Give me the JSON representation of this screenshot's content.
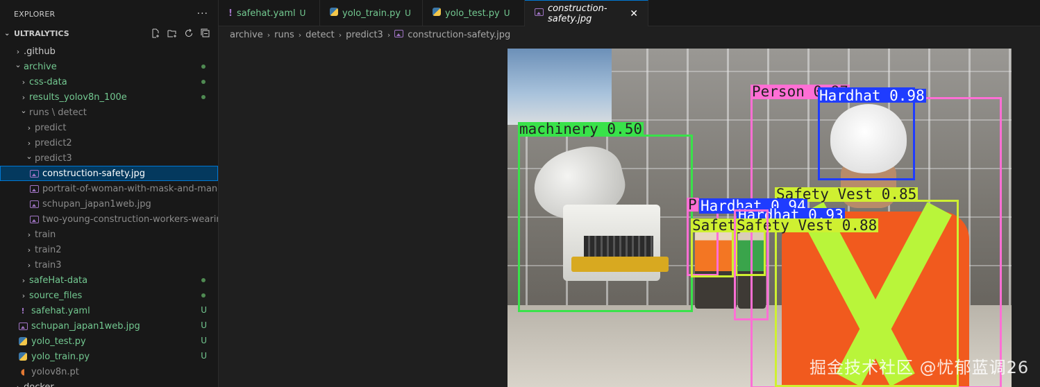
{
  "explorer": {
    "title": "EXPLORER",
    "more": "···",
    "section_title": "ULTRALYTICS",
    "tree": [
      {
        "label": ".github",
        "kind": "folder",
        "depth": 0,
        "open": false,
        "color": "normal",
        "marker": ""
      },
      {
        "label": "archive",
        "kind": "folder",
        "depth": 0,
        "open": true,
        "color": "green",
        "marker": "dot"
      },
      {
        "label": "css-data",
        "kind": "folder",
        "depth": 1,
        "open": false,
        "color": "green",
        "marker": "dot"
      },
      {
        "label": "results_yolov8n_100e",
        "kind": "folder",
        "depth": 1,
        "open": false,
        "color": "green",
        "marker": "dot"
      },
      {
        "label": "runs \\ detect",
        "kind": "folder",
        "depth": 1,
        "open": true,
        "color": "gray",
        "marker": ""
      },
      {
        "label": "predict",
        "kind": "folder",
        "depth": 2,
        "open": false,
        "color": "gray",
        "marker": ""
      },
      {
        "label": "predict2",
        "kind": "folder",
        "depth": 2,
        "open": false,
        "color": "gray",
        "marker": ""
      },
      {
        "label": "predict3",
        "kind": "folder",
        "depth": 2,
        "open": true,
        "color": "gray",
        "marker": ""
      },
      {
        "label": "construction-safety.jpg",
        "kind": "image",
        "depth": 3,
        "color": "normal",
        "marker": "",
        "selected": true
      },
      {
        "label": "portrait-of-woman-with-mask-and-man-w...",
        "kind": "image",
        "depth": 3,
        "color": "gray",
        "marker": ""
      },
      {
        "label": "schupan_japan1web.jpg",
        "kind": "image",
        "depth": 3,
        "color": "gray",
        "marker": ""
      },
      {
        "label": "two-young-construction-workers-wearing-...",
        "kind": "image",
        "depth": 3,
        "color": "gray",
        "marker": ""
      },
      {
        "label": "train",
        "kind": "folder",
        "depth": 2,
        "open": false,
        "color": "gray",
        "marker": ""
      },
      {
        "label": "train2",
        "kind": "folder",
        "depth": 2,
        "open": false,
        "color": "gray",
        "marker": ""
      },
      {
        "label": "train3",
        "kind": "folder",
        "depth": 2,
        "open": false,
        "color": "gray",
        "marker": ""
      },
      {
        "label": "safeHat-data",
        "kind": "folder",
        "depth": 1,
        "open": false,
        "color": "green",
        "marker": "dot"
      },
      {
        "label": "source_files",
        "kind": "folder",
        "depth": 1,
        "open": false,
        "color": "green",
        "marker": "dot"
      },
      {
        "label": "safehat.yaml",
        "kind": "yaml",
        "depth": 1,
        "color": "green",
        "marker": "U"
      },
      {
        "label": "schupan_japan1web.jpg",
        "kind": "image",
        "depth": 1,
        "color": "green",
        "marker": "U"
      },
      {
        "label": "yolo_test.py",
        "kind": "python",
        "depth": 1,
        "color": "green",
        "marker": "U"
      },
      {
        "label": "yolo_train.py",
        "kind": "python",
        "depth": 1,
        "color": "green",
        "marker": "U"
      },
      {
        "label": "yolov8n.pt",
        "kind": "rss",
        "depth": 1,
        "color": "gray",
        "marker": ""
      },
      {
        "label": "docker",
        "kind": "folder",
        "depth": 0,
        "open": false,
        "color": "normal",
        "marker": ""
      }
    ]
  },
  "tabs": [
    {
      "name": "safehat.yaml",
      "status": "U",
      "icon": "yaml-icon",
      "active": false
    },
    {
      "name": "yolo_train.py",
      "status": "U",
      "icon": "python-icon",
      "active": false
    },
    {
      "name": "yolo_test.py",
      "status": "U",
      "icon": "python-icon",
      "active": false
    },
    {
      "name": "construction-safety.jpg",
      "status": "",
      "icon": "image-icon",
      "active": true,
      "close": "✕"
    }
  ],
  "breadcrumb": [
    "archive",
    "runs",
    "detect",
    "predict3",
    "construction-safety.jpg"
  ],
  "detections": [
    {
      "label": "Person 0.97",
      "color": "#ff6fd5"
    },
    {
      "label": "Hardhat 0.98",
      "color": "#1f3cff"
    },
    {
      "label": "machinery 0.50",
      "color": "#39e24a"
    },
    {
      "label": "Safety Vest 0.85",
      "color": "#cff031"
    },
    {
      "label": "P",
      "color": "#ff6fd5"
    },
    {
      "label": "Hardhat 0.94",
      "color": "#1f3cff"
    },
    {
      "label": "Hardhat 0.93",
      "color": "#1f3cff"
    },
    {
      "label": "Safety",
      "color": "#cff031"
    },
    {
      "label": "Safety Vest 0.88",
      "color": "#cff031"
    },
    {
      "label": "",
      "color": "#ff6fd5"
    }
  ],
  "watermark": "掘金技术社区 @忧郁蓝调26"
}
